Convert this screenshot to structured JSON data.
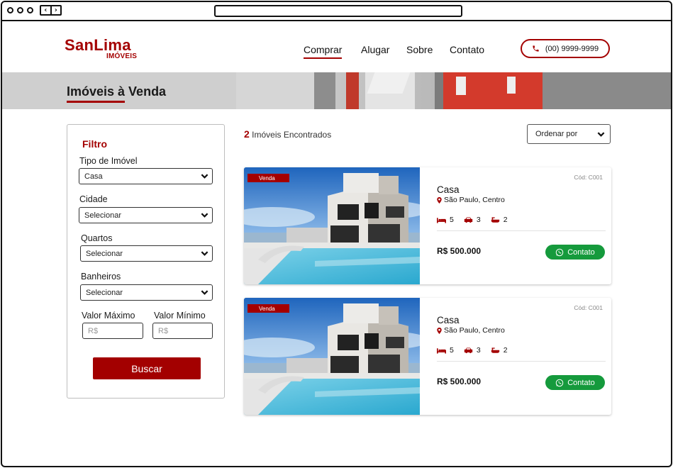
{
  "header": {
    "logo_main": "SanLima",
    "logo_sub": "IMÓVEIS",
    "nav": [
      "Comprar",
      "Alugar",
      "Sobre",
      "Contato"
    ],
    "phone": "(00) 9999-9999"
  },
  "hero": {
    "title": "Imóveis à Venda"
  },
  "filter": {
    "title": "Filtro",
    "tipo_label": "Tipo de Imóvel",
    "tipo_value": "Casa",
    "cidade_label": "Cidade",
    "cidade_value": "Selecionar",
    "quartos_label": "Quartos",
    "quartos_value": "Selecionar",
    "banheiros_label": "Banheiros",
    "banheiros_value": "Selecionar",
    "max_label": "Valor Máximo",
    "min_label": "Valor Mínimo",
    "max_placeholder": "R$",
    "min_placeholder": "R$",
    "button": "Buscar"
  },
  "results": {
    "count": "2",
    "count_label": "Imóveis Encontrados",
    "order_label": "Ordenar por"
  },
  "listings": [
    {
      "tag": "Venda",
      "code": "Cód: C001",
      "title": "Casa",
      "location": "São Paulo, Centro",
      "beds": "5",
      "cars": "3",
      "baths": "2",
      "price": "R$ 500.000",
      "cta": "Contato"
    },
    {
      "tag": "Venda",
      "code": "Cód: C001",
      "title": "Casa",
      "location": "São Paulo, Centro",
      "beds": "5",
      "cars": "3",
      "baths": "2",
      "price": "R$ 500.000",
      "cta": "Contato"
    }
  ],
  "colors": {
    "brand": "#a40000",
    "whatsapp": "#159a3c"
  }
}
